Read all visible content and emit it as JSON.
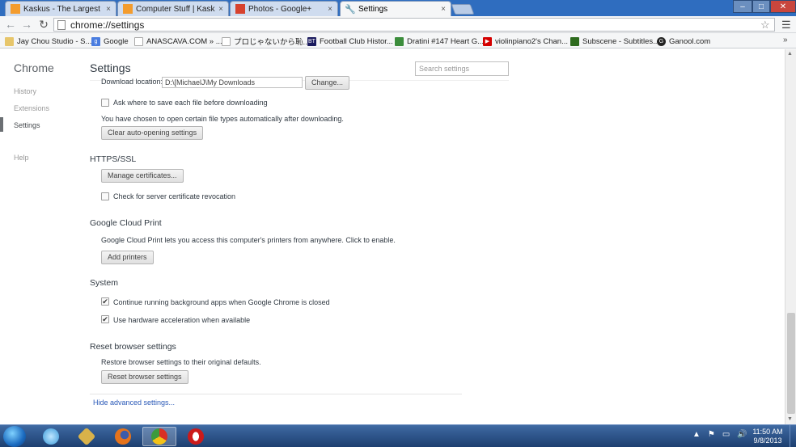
{
  "tabs": [
    {
      "title": "Kaskus - The Largest Indo",
      "icon": "kaskus-favicon",
      "color": "#f39c2e"
    },
    {
      "title": "Computer Stuff | Kaskus -",
      "icon": "kaskus-favicon",
      "color": "#f39c2e"
    },
    {
      "title": "Photos - Google+",
      "icon": "google-plus-favicon",
      "color": "#d7422d"
    },
    {
      "title": "Settings",
      "icon": "wrench-icon",
      "color": "#666666"
    }
  ],
  "tab_close_glyph": "×",
  "window_controls": {
    "minimize": "–",
    "maximize": "□",
    "close": "✕"
  },
  "toolbar": {
    "back": "←",
    "forward": "→",
    "reload": "↻",
    "url": "chrome://settings",
    "star": "☆",
    "menu": "☰"
  },
  "bookmarks": [
    {
      "label": "Jay Chou Studio - S...",
      "icon": "folder-icon",
      "color": "#e7c66b"
    },
    {
      "label": "Google",
      "icon": "google-favicon",
      "color": "#4a7de0"
    },
    {
      "label": "ANASCAVA.COM » ...",
      "icon": "page-icon",
      "color": "#bfbfbf"
    },
    {
      "label": "プロじゃないから恥...",
      "icon": "page-icon",
      "color": "#bfbfbf"
    },
    {
      "label": "Football Club Histor...",
      "icon": "bt-favicon",
      "color": "#1a1a5e"
    },
    {
      "label": "Dratini #147 Heart G...",
      "icon": "pokemon-favicon",
      "color": "#3c8d3c"
    },
    {
      "label": "violinpiano2's Chan...",
      "icon": "youtube-favicon",
      "color": "#d40000"
    },
    {
      "label": "Subscene - Subtitles...",
      "icon": "subscene-favicon",
      "color": "#2e6b1e"
    },
    {
      "label": "Ganool.com",
      "icon": "ganool-favicon",
      "color": "#222222"
    }
  ],
  "bookmarks_more": "»",
  "sidebar": {
    "brand": "Chrome",
    "items": [
      {
        "label": "History",
        "active": false
      },
      {
        "label": "Extensions",
        "active": false
      },
      {
        "label": "Settings",
        "active": true
      },
      {
        "label": "Help",
        "active": false
      }
    ]
  },
  "main": {
    "title": "Settings",
    "search_placeholder": "Search settings",
    "downloads": {
      "location_label": "Download location:",
      "location_value": "D:\\[MichaelJ\\My Downloads",
      "change_button": "Change...",
      "ask_label": "Ask where to save each file before downloading",
      "ask_checked": false,
      "auto_open_text": "You have chosen to open certain file types automatically after downloading.",
      "clear_button": "Clear auto-opening settings"
    },
    "https": {
      "title": "HTTPS/SSL",
      "manage_button": "Manage certificates...",
      "revocation_label": "Check for server certificate revocation",
      "revocation_checked": false
    },
    "cloud_print": {
      "title": "Google Cloud Print",
      "description": "Google Cloud Print lets you access this computer's printers from anywhere. Click to enable.",
      "add_button": "Add printers"
    },
    "system": {
      "title": "System",
      "background_label": "Continue running background apps when Google Chrome is closed",
      "background_checked": true,
      "hw_label": "Use hardware acceleration when available",
      "hw_checked": true
    },
    "reset": {
      "title": "Reset browser settings",
      "description": "Restore browser settings to their original defaults.",
      "button": "Reset browser settings"
    },
    "hide_advanced": "Hide advanced settings..."
  },
  "checkmark": "✔",
  "taskbar": {
    "apps": [
      {
        "name": "windows-media-icon",
        "color": "#3a9ad9"
      },
      {
        "name": "tools-icon",
        "color": "#d9b24a"
      },
      {
        "name": "firefox-icon",
        "color": "#e5731c"
      },
      {
        "name": "chrome-icon",
        "color": "#3d9a3d"
      },
      {
        "name": "opera-icon",
        "color": "#cc1a1a"
      }
    ],
    "tray_glyphs": {
      "arrow": "▲",
      "flag": "⚑",
      "network": "▭",
      "volume": "🔊"
    },
    "time": "11:50 AM",
    "date": "9/8/2013"
  }
}
